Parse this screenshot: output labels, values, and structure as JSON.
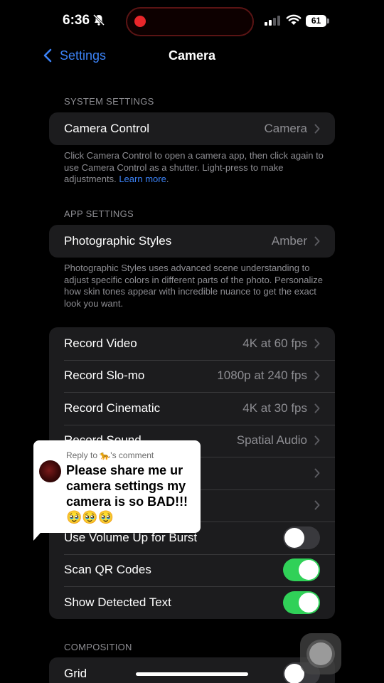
{
  "status_bar": {
    "time": "6:36",
    "battery": "61"
  },
  "nav": {
    "back_label": "Settings",
    "title": "Camera"
  },
  "system_settings": {
    "header": "SYSTEM SETTINGS",
    "rows": [
      {
        "label": "Camera Control",
        "value": "Camera"
      }
    ],
    "footnote": "Click Camera Control to open a camera app, then click again to use Camera Control as a shutter. Light-press to make adjustments.",
    "footnote_link": "Learn more"
  },
  "app_settings": {
    "header": "APP SETTINGS",
    "rows": [
      {
        "label": "Photographic Styles",
        "value": "Amber"
      }
    ],
    "footnote": "Photographic Styles uses advanced scene understanding to adjust specific colors in different parts of the photo. Personalize how skin tones appear with incredible nuance to get the exact look you want."
  },
  "record_group": {
    "rows": [
      {
        "label": "Record Video",
        "value": "4K at 60 fps"
      },
      {
        "label": "Record Slo-mo",
        "value": "1080p at 240 fps"
      },
      {
        "label": "Record Cinematic",
        "value": "4K at 30 fps"
      },
      {
        "label": "Record Sound",
        "value": "Spatial Audio"
      }
    ],
    "toggles": [
      {
        "label": "Use Volume Up for Burst",
        "on": false
      },
      {
        "label": "Scan QR Codes",
        "on": true
      },
      {
        "label": "Show Detected Text",
        "on": true
      }
    ]
  },
  "composition": {
    "header": "COMPOSITION",
    "rows": [
      {
        "label": "Grid",
        "on": false
      }
    ]
  },
  "comment_overlay": {
    "reply_to": "Reply to 🐆's comment",
    "text": "Please share me ur camera settings my camera is so BAD!!! 🥹🥹🥹"
  },
  "colors": {
    "accent": "#3b82f6",
    "toggle_on": "#30d158",
    "cell_bg": "#1c1c1e",
    "record_dot": "#e8262a"
  }
}
